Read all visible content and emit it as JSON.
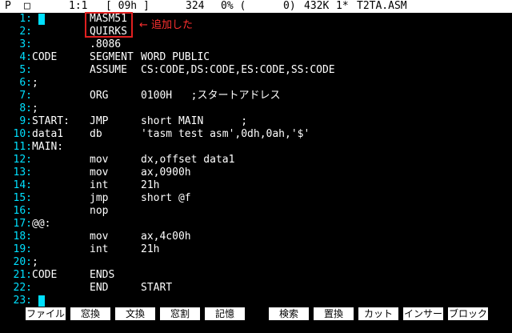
{
  "status": {
    "mode": "P",
    "box": "□",
    "position": "1:1",
    "column": "[ 09h ]",
    "size": "324",
    "percent": "0% (",
    "count": "0)",
    "memory": "432K",
    "window": "1*",
    "filename": "T2TA.ASM"
  },
  "annotation": {
    "text": "← 追加した"
  },
  "lines": [
    {
      "n": "1",
      "label": "",
      "op": "MASM51",
      "args": "",
      "cursor": true
    },
    {
      "n": "2",
      "label": "",
      "op": "QUIRKS",
      "args": ""
    },
    {
      "n": "3",
      "label": "",
      "op": ".8086",
      "args": ""
    },
    {
      "n": "4",
      "label": "CODE",
      "op": "SEGMENT",
      "args": "WORD PUBLIC"
    },
    {
      "n": "5",
      "label": "",
      "op": "ASSUME",
      "args": "CS:CODE,DS:CODE,ES:CODE,SS:CODE"
    },
    {
      "n": "6",
      "label": ";",
      "op": "",
      "args": ""
    },
    {
      "n": "7",
      "label": "",
      "op": "ORG",
      "args": "0100H   ;スタートアドレス"
    },
    {
      "n": "8",
      "label": ";",
      "op": "",
      "args": ""
    },
    {
      "n": "9",
      "label": "START:",
      "op": "JMP",
      "args": "short MAIN      ;"
    },
    {
      "n": "10",
      "label": "data1",
      "op": "db",
      "args": "'tasm test asm',0dh,0ah,'$'"
    },
    {
      "n": "11",
      "label": "MAIN:",
      "op": "",
      "args": ""
    },
    {
      "n": "12",
      "label": "",
      "op": "mov",
      "args": "dx,offset data1"
    },
    {
      "n": "13",
      "label": "",
      "op": "mov",
      "args": "ax,0900h"
    },
    {
      "n": "14",
      "label": "",
      "op": "int",
      "args": "21h"
    },
    {
      "n": "15",
      "label": "",
      "op": "jmp",
      "args": "short @f"
    },
    {
      "n": "16",
      "label": "",
      "op": "nop",
      "args": ""
    },
    {
      "n": "17",
      "label": "@@:",
      "op": "",
      "args": ""
    },
    {
      "n": "18",
      "label": "",
      "op": "mov",
      "args": "ax,4c00h"
    },
    {
      "n": "19",
      "label": "",
      "op": "int",
      "args": "21h"
    },
    {
      "n": "20",
      "label": ";",
      "op": "",
      "args": ""
    },
    {
      "n": "21",
      "label": "CODE",
      "op": "ENDS",
      "args": ""
    },
    {
      "n": "22",
      "label": "",
      "op": "END",
      "args": "START"
    },
    {
      "n": "23",
      "label": "",
      "op": "",
      "args": "",
      "eof": true
    }
  ],
  "fkeys": [
    "ファイル",
    "窓換",
    "文換",
    "窓割",
    "記憶",
    "検索",
    "置換",
    "カット",
    "インサート",
    "ブロック"
  ]
}
